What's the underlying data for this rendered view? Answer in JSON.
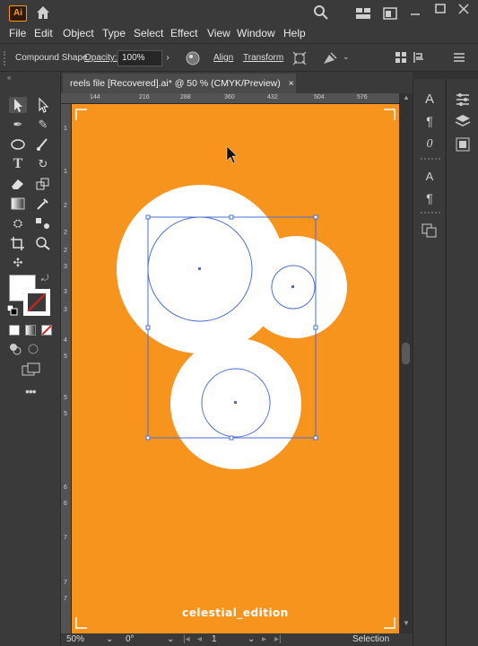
{
  "app": {
    "logo": "Ai",
    "icons": [
      "home-icon",
      "search-icon",
      "workspace-icon",
      "arrange-icon",
      "minimize-icon",
      "maximize-icon",
      "close-icon"
    ]
  },
  "menu": [
    "File",
    "Edit",
    "Object",
    "Type",
    "Select",
    "Effect",
    "View",
    "Window",
    "Help"
  ],
  "control": {
    "selection_type": "Compound Shape",
    "opacity_label": "Opacity:",
    "opacity_value": "100%",
    "align_label": "Align",
    "transform_label": "Transform"
  },
  "document": {
    "tab_title": "reels file [Recovered].ai* @ 50 % (CMYK/Preview)",
    "close": "×"
  },
  "ruler": {
    "h_ticks": [
      "144",
      "216",
      "288",
      "360",
      "432",
      "504",
      "576"
    ],
    "v_ticks": [
      "1",
      "1",
      "2",
      "2",
      "2",
      "3",
      "3",
      "3",
      "4",
      "5",
      "5",
      "5",
      "6",
      "6",
      "7",
      "7",
      "7"
    ]
  },
  "artboard": {
    "background": "#f7941e",
    "caption": "celestial_edition"
  },
  "status": {
    "zoom": "50%",
    "rotation": "0°",
    "artboard_number": "1",
    "mode": "Selection"
  },
  "colors": {
    "accent": "#ff9a00",
    "selection": "#4a6fd6",
    "shape_fill": "#ffffff"
  }
}
